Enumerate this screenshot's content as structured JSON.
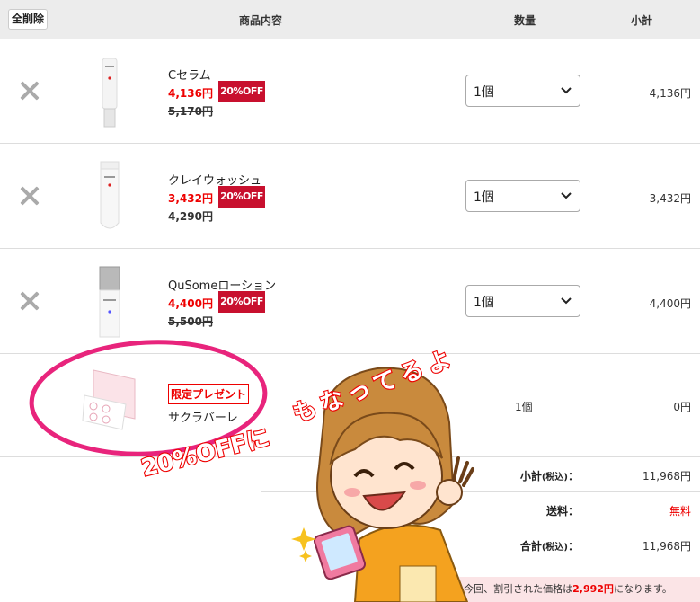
{
  "header": {
    "delete_all": "全削除",
    "col_product": "商品内容",
    "col_qty": "数量",
    "col_subtotal": "小計"
  },
  "items": [
    {
      "name": "Cセラム",
      "price": "4,136円",
      "badge": "20%OFF",
      "old_price": "5,170円",
      "qty": "1個",
      "subtotal": "4,136円"
    },
    {
      "name": "クレイウォッシュ",
      "price": "3,432円",
      "badge": "20%OFF",
      "old_price": "4,290円",
      "qty": "1個",
      "subtotal": "3,432円"
    },
    {
      "name": "QuSomeローション",
      "price": "4,400円",
      "badge": "20%OFF",
      "old_price": "5,500円",
      "qty": "1個",
      "subtotal": "4,400円"
    }
  ],
  "gift": {
    "tag": "限定プレゼント",
    "name": "サクラバーレ",
    "qty": "1個",
    "subtotal": "0円"
  },
  "summary": {
    "subtotal_label": "小計",
    "tax_note": "(税込)",
    "colon": "：",
    "subtotal_value": "11,968円",
    "shipping_label": "送料",
    "shipping_value": "無料",
    "total_label": "合計",
    "total_value": "11,968円"
  },
  "note": {
    "prefix": "今回、割引された価格は",
    "amount": "2,992円",
    "suffix": "になります。"
  },
  "annotation": {
    "text_a": "20%OFFに",
    "text_b": "もなってるよ",
    "circle_color": "#e8247c"
  },
  "colors": {
    "accent_red": "#e00000",
    "badge_red": "#c8102e",
    "header_bg": "#ececec",
    "note_bg": "#fbe4e6"
  }
}
